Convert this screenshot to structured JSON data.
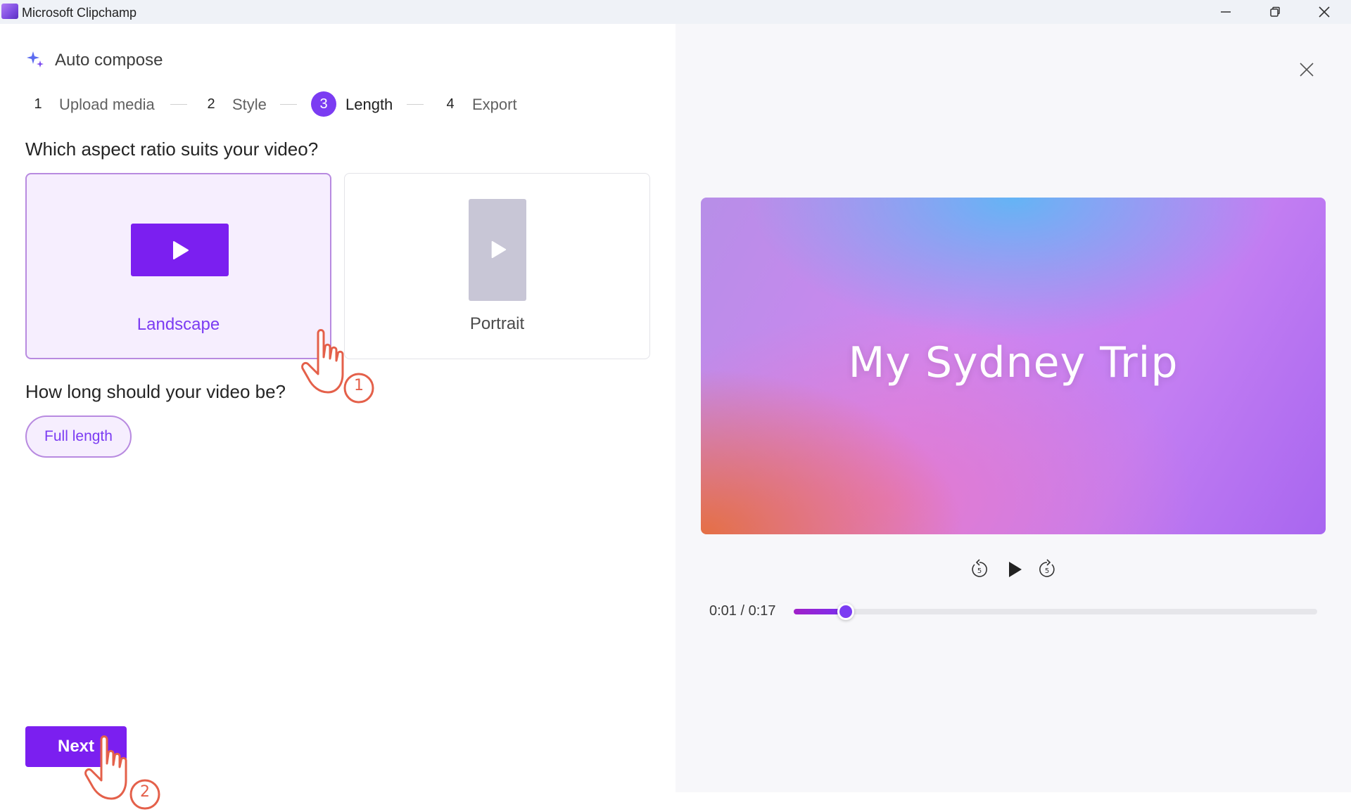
{
  "window": {
    "app_title": "Microsoft Clipchamp",
    "controls": [
      "minimize-icon",
      "restore-icon",
      "close-icon"
    ]
  },
  "wizard": {
    "title": "Auto compose",
    "icon": "sparkle-icon",
    "steps": [
      {
        "number": "1",
        "label": "Upload media",
        "active": false
      },
      {
        "number": "2",
        "label": "Style",
        "active": false
      },
      {
        "number": "3",
        "label": "Length",
        "active": true
      },
      {
        "number": "4",
        "label": "Export",
        "active": false
      }
    ],
    "aspect_question": "Which aspect ratio suits your video?",
    "aspect_options": [
      {
        "label": "Landscape",
        "selected": true
      },
      {
        "label": "Portrait",
        "selected": false
      }
    ],
    "length_question": "How long should your video be?",
    "length_options": [
      {
        "label": "Full length",
        "selected": true
      }
    ],
    "next_label": "Next"
  },
  "preview": {
    "video_title": "My Sydney Trip",
    "controls": [
      "rewind-5-icon",
      "play-icon",
      "forward-5-icon"
    ],
    "current_time": "0:01",
    "duration": "0:17",
    "time_readout": "0:01 / 0:17",
    "progress_fraction": 0.1
  },
  "tutorial": {
    "markers": [
      "1",
      "2"
    ]
  },
  "colors": {
    "accent": "#7b3cf2",
    "accent_dark": "#7b1ff0",
    "selected_bg": "#f6eefe",
    "panel_bg": "#f7f7fa",
    "hand_outline": "#e4604a"
  }
}
